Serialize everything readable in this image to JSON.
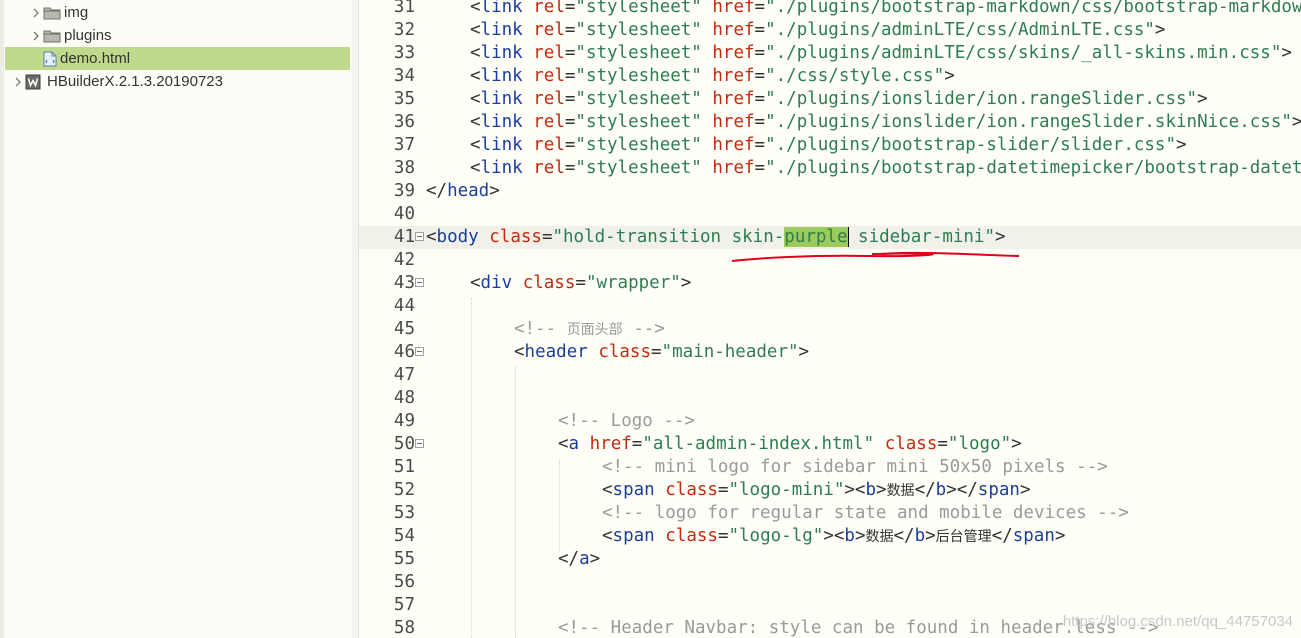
{
  "sidebar": {
    "items": [
      {
        "label": "img",
        "kind": "folder"
      },
      {
        "label": "plugins",
        "kind": "folder"
      },
      {
        "label": "demo.html",
        "kind": "file",
        "selected": true
      },
      {
        "label": "HBuilderX.2.1.3.20190723",
        "kind": "project"
      }
    ]
  },
  "editor": {
    "lines": [
      {
        "n": "31",
        "parts": [
          [
            "  ",
            "p"
          ],
          [
            "<",
            "b"
          ],
          [
            "link",
            "t"
          ],
          [
            " ",
            "p"
          ],
          [
            "rel",
            "a"
          ],
          [
            "=",
            "e"
          ],
          [
            "\"stylesheet\"",
            "s"
          ],
          [
            " ",
            "p"
          ],
          [
            "href",
            "a"
          ],
          [
            "=",
            "e"
          ],
          [
            "\"./plugins/bootstrap-markdown/css/bootstrap-markdown.min.css\"",
            "s"
          ],
          [
            ">",
            "b"
          ]
        ]
      },
      {
        "n": "32",
        "parts": [
          [
            "  ",
            "p"
          ],
          [
            "<",
            "b"
          ],
          [
            "link",
            "t"
          ],
          [
            " ",
            "p"
          ],
          [
            "rel",
            "a"
          ],
          [
            "=",
            "e"
          ],
          [
            "\"stylesheet\"",
            "s"
          ],
          [
            " ",
            "p"
          ],
          [
            "href",
            "a"
          ],
          [
            "=",
            "e"
          ],
          [
            "\"./plugins/adminLTE/css/AdminLTE.css\"",
            "s"
          ],
          [
            ">",
            "b"
          ]
        ]
      },
      {
        "n": "33",
        "parts": [
          [
            "  ",
            "p"
          ],
          [
            "<",
            "b"
          ],
          [
            "link",
            "t"
          ],
          [
            " ",
            "p"
          ],
          [
            "rel",
            "a"
          ],
          [
            "=",
            "e"
          ],
          [
            "\"stylesheet\"",
            "s"
          ],
          [
            " ",
            "p"
          ],
          [
            "href",
            "a"
          ],
          [
            "=",
            "e"
          ],
          [
            "\"./plugins/adminLTE/css/skins/_all-skins.min.css\"",
            "s"
          ],
          [
            ">",
            "b"
          ]
        ]
      },
      {
        "n": "34",
        "parts": [
          [
            "  ",
            "p"
          ],
          [
            "<",
            "b"
          ],
          [
            "link",
            "t"
          ],
          [
            " ",
            "p"
          ],
          [
            "rel",
            "a"
          ],
          [
            "=",
            "e"
          ],
          [
            "\"stylesheet\"",
            "s"
          ],
          [
            " ",
            "p"
          ],
          [
            "href",
            "a"
          ],
          [
            "=",
            "e"
          ],
          [
            "\"./css/style.css\"",
            "s"
          ],
          [
            ">",
            "b"
          ]
        ]
      },
      {
        "n": "35",
        "parts": [
          [
            "  ",
            "p"
          ],
          [
            "<",
            "b"
          ],
          [
            "link",
            "t"
          ],
          [
            " ",
            "p"
          ],
          [
            "rel",
            "a"
          ],
          [
            "=",
            "e"
          ],
          [
            "\"stylesheet\"",
            "s"
          ],
          [
            " ",
            "p"
          ],
          [
            "href",
            "a"
          ],
          [
            "=",
            "e"
          ],
          [
            "\"./plugins/ionslider/ion.rangeSlider.css\"",
            "s"
          ],
          [
            ">",
            "b"
          ]
        ]
      },
      {
        "n": "36",
        "parts": [
          [
            "  ",
            "p"
          ],
          [
            "<",
            "b"
          ],
          [
            "link",
            "t"
          ],
          [
            " ",
            "p"
          ],
          [
            "rel",
            "a"
          ],
          [
            "=",
            "e"
          ],
          [
            "\"stylesheet\"",
            "s"
          ],
          [
            " ",
            "p"
          ],
          [
            "href",
            "a"
          ],
          [
            "=",
            "e"
          ],
          [
            "\"./plugins/ionslider/ion.rangeSlider.skinNice.css\"",
            "s"
          ],
          [
            ">",
            "b"
          ]
        ]
      },
      {
        "n": "37",
        "parts": [
          [
            "  ",
            "p"
          ],
          [
            "<",
            "b"
          ],
          [
            "link",
            "t"
          ],
          [
            " ",
            "p"
          ],
          [
            "rel",
            "a"
          ],
          [
            "=",
            "e"
          ],
          [
            "\"stylesheet\"",
            "s"
          ],
          [
            " ",
            "p"
          ],
          [
            "href",
            "a"
          ],
          [
            "=",
            "e"
          ],
          [
            "\"./plugins/bootstrap-slider/slider.css\"",
            "s"
          ],
          [
            ">",
            "b"
          ]
        ]
      },
      {
        "n": "38",
        "parts": [
          [
            "  ",
            "p"
          ],
          [
            "<",
            "b"
          ],
          [
            "link",
            "t"
          ],
          [
            " ",
            "p"
          ],
          [
            "rel",
            "a"
          ],
          [
            "=",
            "e"
          ],
          [
            "\"stylesheet\"",
            "s"
          ],
          [
            " ",
            "p"
          ],
          [
            "href",
            "a"
          ],
          [
            "=",
            "e"
          ],
          [
            "\"./plugins/bootstrap-datetimepicker/bootstrap-datetimepicker.css\"",
            "s"
          ],
          [
            ">",
            "b"
          ]
        ]
      },
      {
        "n": "39",
        "parts": [
          [
            "</",
            "b"
          ],
          [
            "head",
            "t"
          ],
          [
            ">",
            "b"
          ]
        ]
      },
      {
        "n": "40",
        "parts": []
      },
      {
        "n": "41",
        "fold": true,
        "current": true,
        "parts": [
          [
            "<",
            "b"
          ],
          [
            "body",
            "t"
          ],
          [
            " ",
            "p"
          ],
          [
            "class",
            "a"
          ],
          [
            "=",
            "e"
          ],
          [
            "\"hold-transition skin-",
            "s"
          ],
          [
            "purple",
            "h"
          ],
          [
            "|",
            "c"
          ],
          [
            " sidebar-mini\"",
            "s"
          ],
          [
            ">",
            "b"
          ]
        ]
      },
      {
        "n": "42",
        "parts": []
      },
      {
        "n": "43",
        "fold": true,
        "parts": [
          [
            "  ",
            "p"
          ],
          [
            "<",
            "b"
          ],
          [
            "div",
            "t"
          ],
          [
            " ",
            "p"
          ],
          [
            "class",
            "a"
          ],
          [
            "=",
            "e"
          ],
          [
            "\"wrapper\"",
            "s"
          ],
          [
            ">",
            "b"
          ]
        ]
      },
      {
        "n": "44",
        "parts": []
      },
      {
        "n": "45",
        "parts": [
          [
            "    ",
            "p"
          ],
          [
            "<!-- ",
            "m"
          ],
          [
            "页面头部",
            "j"
          ],
          [
            " -->",
            "m"
          ]
        ]
      },
      {
        "n": "46",
        "fold": true,
        "parts": [
          [
            "    ",
            "p"
          ],
          [
            "<",
            "b"
          ],
          [
            "header",
            "t"
          ],
          [
            " ",
            "p"
          ],
          [
            "class",
            "a"
          ],
          [
            "=",
            "e"
          ],
          [
            "\"main-header\"",
            "s"
          ],
          [
            ">",
            "b"
          ]
        ]
      },
      {
        "n": "47",
        "parts": []
      },
      {
        "n": "48",
        "parts": []
      },
      {
        "n": "49",
        "parts": [
          [
            "      ",
            "p"
          ],
          [
            "<!-- Logo -->",
            "m"
          ]
        ]
      },
      {
        "n": "50",
        "fold": true,
        "parts": [
          [
            "      ",
            "p"
          ],
          [
            "<",
            "b"
          ],
          [
            "a",
            "t"
          ],
          [
            " ",
            "p"
          ],
          [
            "href",
            "a"
          ],
          [
            "=",
            "e"
          ],
          [
            "\"all-admin-index.html\"",
            "s"
          ],
          [
            " ",
            "p"
          ],
          [
            "class",
            "a"
          ],
          [
            "=",
            "e"
          ],
          [
            "\"logo\"",
            "s"
          ],
          [
            ">",
            "b"
          ]
        ]
      },
      {
        "n": "51",
        "parts": [
          [
            "        ",
            "p"
          ],
          [
            "<!-- mini logo for sidebar mini 50x50 pixels -->",
            "m"
          ]
        ]
      },
      {
        "n": "52",
        "parts": [
          [
            "        ",
            "p"
          ],
          [
            "<",
            "b"
          ],
          [
            "span",
            "t"
          ],
          [
            " ",
            "p"
          ],
          [
            "class",
            "a"
          ],
          [
            "=",
            "e"
          ],
          [
            "\"logo-mini\"",
            "s"
          ],
          [
            "><",
            "b"
          ],
          [
            "b",
            "t"
          ],
          [
            ">",
            "b"
          ],
          [
            "数据",
            "k"
          ],
          [
            "</",
            "b"
          ],
          [
            "b",
            "t"
          ],
          [
            "></",
            "b"
          ],
          [
            "span",
            "t"
          ],
          [
            ">",
            "b"
          ]
        ]
      },
      {
        "n": "53",
        "parts": [
          [
            "        ",
            "p"
          ],
          [
            "<!-- logo for regular state and mobile devices -->",
            "m"
          ]
        ]
      },
      {
        "n": "54",
        "parts": [
          [
            "        ",
            "p"
          ],
          [
            "<",
            "b"
          ],
          [
            "span",
            "t"
          ],
          [
            " ",
            "p"
          ],
          [
            "class",
            "a"
          ],
          [
            "=",
            "e"
          ],
          [
            "\"logo-lg\"",
            "s"
          ],
          [
            "><",
            "b"
          ],
          [
            "b",
            "t"
          ],
          [
            ">",
            "b"
          ],
          [
            "数据",
            "k"
          ],
          [
            "</",
            "b"
          ],
          [
            "b",
            "t"
          ],
          [
            ">",
            "b"
          ],
          [
            "后台管理",
            "k"
          ],
          [
            "</",
            "b"
          ],
          [
            "span",
            "t"
          ],
          [
            ">",
            "b"
          ]
        ]
      },
      {
        "n": "55",
        "parts": [
          [
            "      ",
            "p"
          ],
          [
            "</",
            "b"
          ],
          [
            "a",
            "t"
          ],
          [
            ">",
            "b"
          ]
        ]
      },
      {
        "n": "56",
        "parts": []
      },
      {
        "n": "57",
        "parts": []
      },
      {
        "n": "58",
        "parts": [
          [
            "      ",
            "p"
          ],
          [
            "<!-- Header Navbar: style can be found in header.less -->",
            "m"
          ]
        ]
      }
    ]
  },
  "annotation_color": "#e0001b",
  "watermark": "https://blog.csdn.net/qq_44757034"
}
